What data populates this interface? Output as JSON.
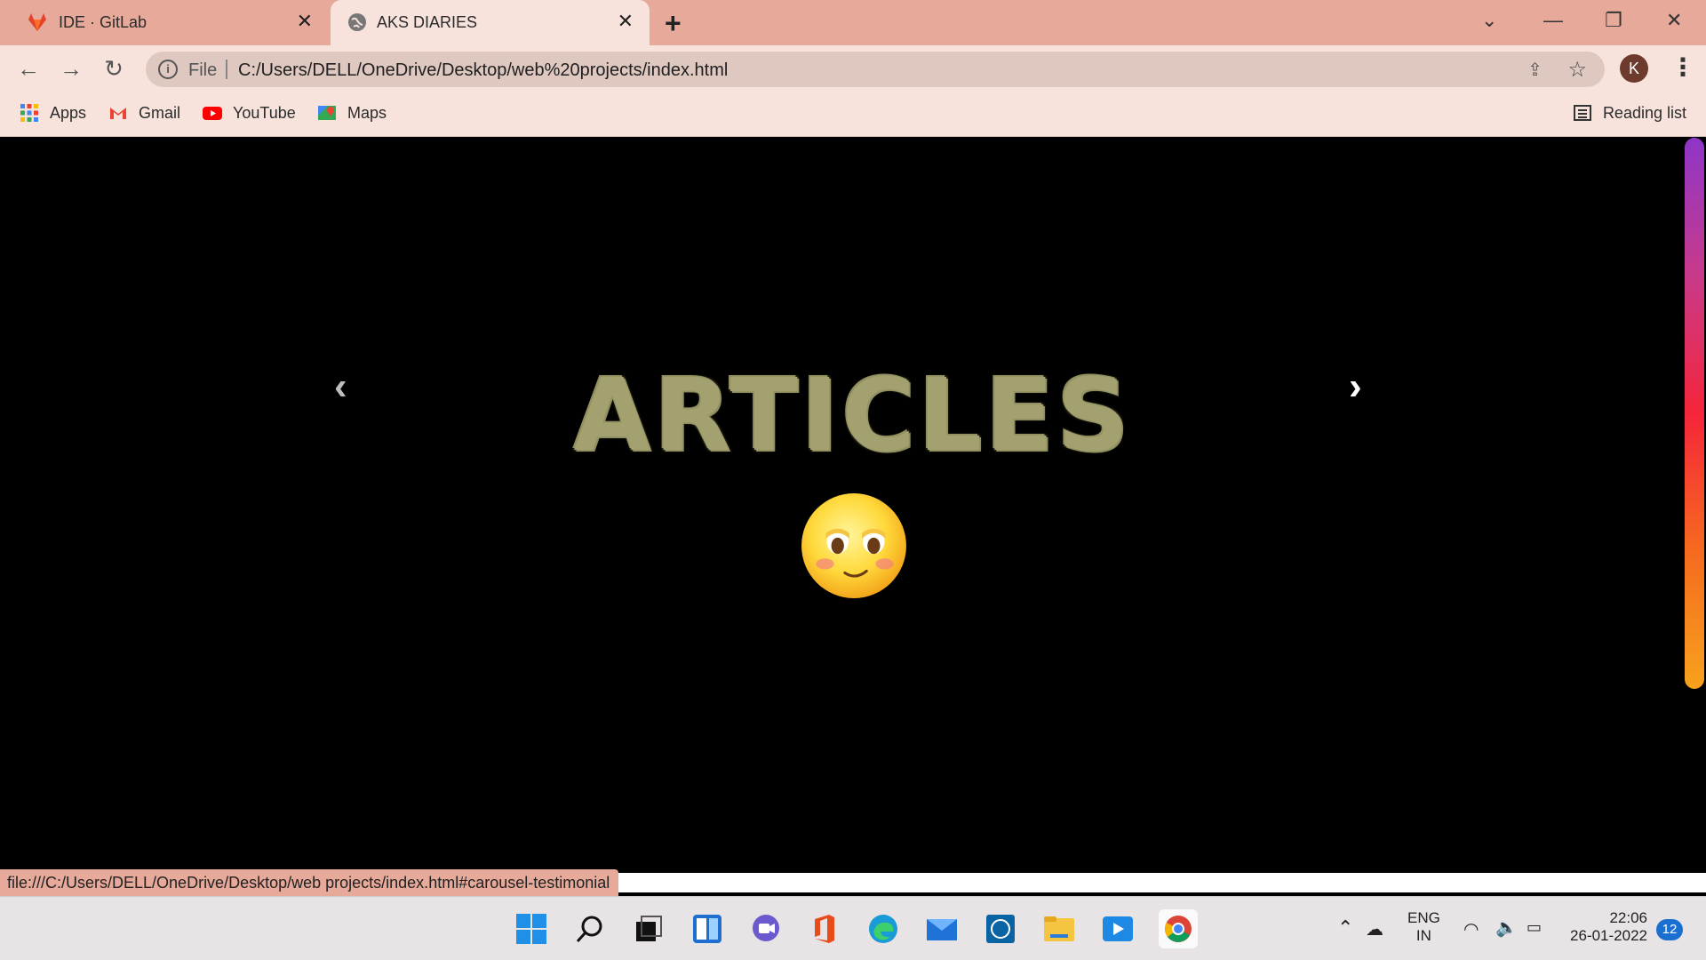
{
  "tabs": [
    {
      "title": "IDE · GitLab",
      "active": false
    },
    {
      "title": "AKS DIARIES",
      "active": true
    }
  ],
  "toolbar": {
    "scheme": "File",
    "url": "C:/Users/DELL/OneDrive/Desktop/web%20projects/index.html",
    "profile_initial": "K"
  },
  "bookmarks": [
    {
      "label": "Apps",
      "icon": "apps-grid-icon"
    },
    {
      "label": "Gmail",
      "icon": "gmail-icon"
    },
    {
      "label": "YouTube",
      "icon": "youtube-icon"
    },
    {
      "label": "Maps",
      "icon": "maps-icon"
    }
  ],
  "reading_list": "Reading list",
  "page": {
    "heading": "ARTICLES",
    "status_url": "file:///C:/Users/DELL/OneDrive/Desktop/web projects/index.html#carousel-testimonial",
    "scrollbar_gradient": [
      "#8e36c8",
      "#c83a8a",
      "#f5253a",
      "#f66a1f",
      "#f7a21d"
    ]
  },
  "taskbar": {
    "language_line1": "ENG",
    "language_line2": "IN",
    "time": "22:06",
    "date": "26-01-2022",
    "notifications": "12",
    "apps": [
      "start-icon",
      "search-icon",
      "task-view-icon",
      "widgets-icon",
      "teams-chat-icon",
      "office-icon",
      "edge-icon",
      "mail-icon",
      "dell-icon",
      "file-explorer-icon",
      "media-player-icon",
      "chrome-icon"
    ]
  }
}
